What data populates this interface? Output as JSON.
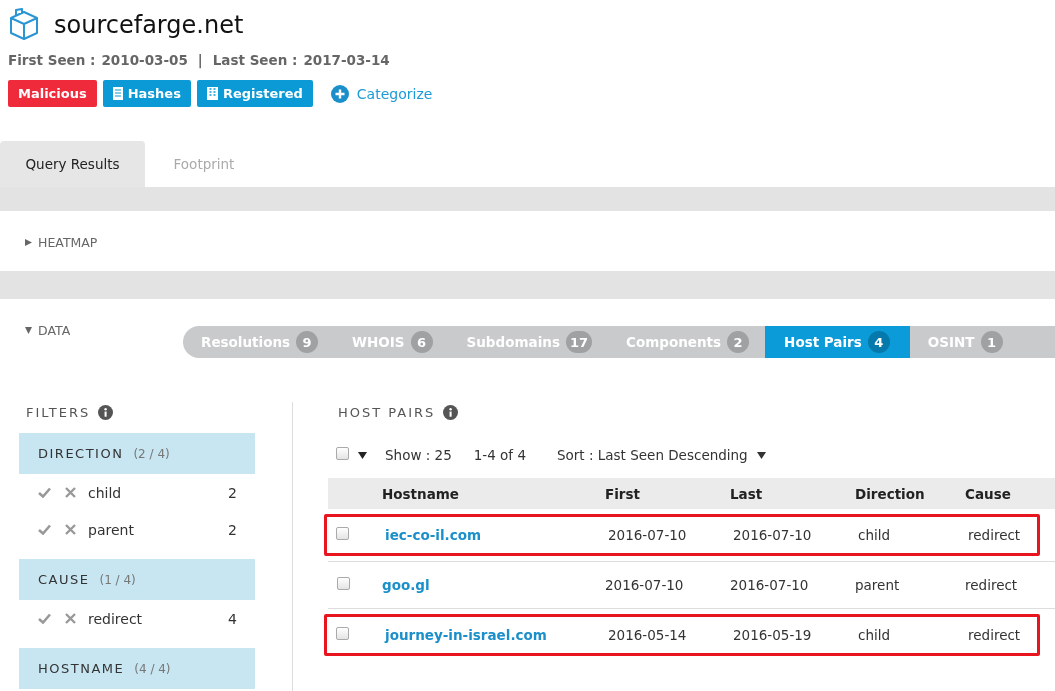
{
  "domain": {
    "name": "sourcefarge.net",
    "first_seen_label": "First Seen :",
    "first_seen": "2010-03-05",
    "separator": "|",
    "last_seen_label": "Last Seen :",
    "last_seen": "2017-03-14"
  },
  "tags": [
    {
      "label": "Malicious",
      "kind": "danger"
    },
    {
      "label": "Hashes",
      "kind": "hashes"
    },
    {
      "label": "Registered",
      "kind": "registered"
    }
  ],
  "categorize": "Categorize",
  "page_tabs": [
    {
      "label": "Query Results",
      "selected": true
    },
    {
      "label": "Footprint",
      "selected": false
    }
  ],
  "heatmap": {
    "label": "HEATMAP",
    "expanded": false
  },
  "data": {
    "label": "DATA",
    "expanded": true
  },
  "data_tabs": [
    {
      "label": "Resolutions",
      "count": "9",
      "selected": false
    },
    {
      "label": "WHOIS",
      "count": "6",
      "selected": false
    },
    {
      "label": "Subdomains",
      "count": "17",
      "selected": false
    },
    {
      "label": "Components",
      "count": "2",
      "selected": false
    },
    {
      "label": "Host Pairs",
      "count": "4",
      "selected": true
    },
    {
      "label": "OSINT",
      "count": "1",
      "selected": false
    }
  ],
  "filters": {
    "title": "FILTERS",
    "groups": [
      {
        "name": "DIRECTION",
        "count": "(2 / 4)",
        "items": [
          {
            "label": "child",
            "count": "2"
          },
          {
            "label": "parent",
            "count": "2"
          }
        ]
      },
      {
        "name": "CAUSE",
        "count": "(1 / 4)",
        "items": [
          {
            "label": "redirect",
            "count": "4"
          }
        ]
      },
      {
        "name": "HOSTNAME",
        "count": "(4 / 4)"
      }
    ]
  },
  "host_pairs": {
    "title": "HOST PAIRS",
    "select_all_checked": false,
    "show": "Show : 25",
    "range": "1-4 of 4",
    "sort": "Sort : Last Seen Descending",
    "columns": [
      "Hostname",
      "First",
      "Last",
      "Direction",
      "Cause"
    ],
    "rows": [
      {
        "hostname": "iec-co-il.com",
        "first": "2016-07-10",
        "last": "2016-07-10",
        "direction": "child",
        "cause": "redirect",
        "checked": false,
        "highlighted": true
      },
      {
        "hostname": "goo.gl",
        "first": "2016-07-10",
        "last": "2016-07-10",
        "direction": "parent",
        "cause": "redirect",
        "checked": false,
        "highlighted": false
      },
      {
        "hostname": "journey-in-israel.com",
        "first": "2016-05-14",
        "last": "2016-05-19",
        "direction": "child",
        "cause": "redirect",
        "checked": false,
        "highlighted": true
      }
    ]
  }
}
